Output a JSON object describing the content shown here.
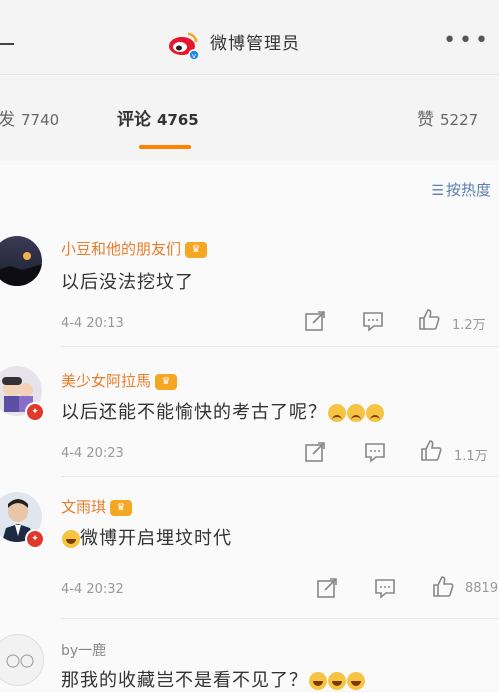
{
  "header": {
    "title": "微博管理员",
    "more_label": "•••"
  },
  "tabs": [
    {
      "label": "转发",
      "visible_label": "发",
      "count": "7740"
    },
    {
      "label": "评论",
      "count": "4765"
    },
    {
      "label": "赞",
      "count": "5227"
    }
  ],
  "sort": {
    "label": "按热度"
  },
  "comments": [
    {
      "name": "小豆和他的朋友们",
      "text": "以后没法挖坟了",
      "time": "4-4 20:13",
      "likes": "1.2万"
    },
    {
      "name": "美少女阿拉馬",
      "text": "以后还能不能愉快的考古了呢？",
      "time": "4-4 20:23",
      "likes": "1.1万"
    },
    {
      "name": "文雨琪",
      "text": "微博开启埋坟时代",
      "time": "4-4 20:32",
      "likes": "8819"
    },
    {
      "name": "by一鹿",
      "text": "那我的收藏岂不是看不见了？"
    }
  ],
  "colors": {
    "accent": "#ff8200",
    "username": "#e87d2a",
    "link": "#5b7fb0"
  },
  "icons": [
    "weibo-logo",
    "back-icon",
    "more-icon",
    "sort-icon",
    "share-icon",
    "reply-icon",
    "like-icon",
    "vip-crown-icon",
    "laugh-emoji",
    "sad-emoji"
  ]
}
